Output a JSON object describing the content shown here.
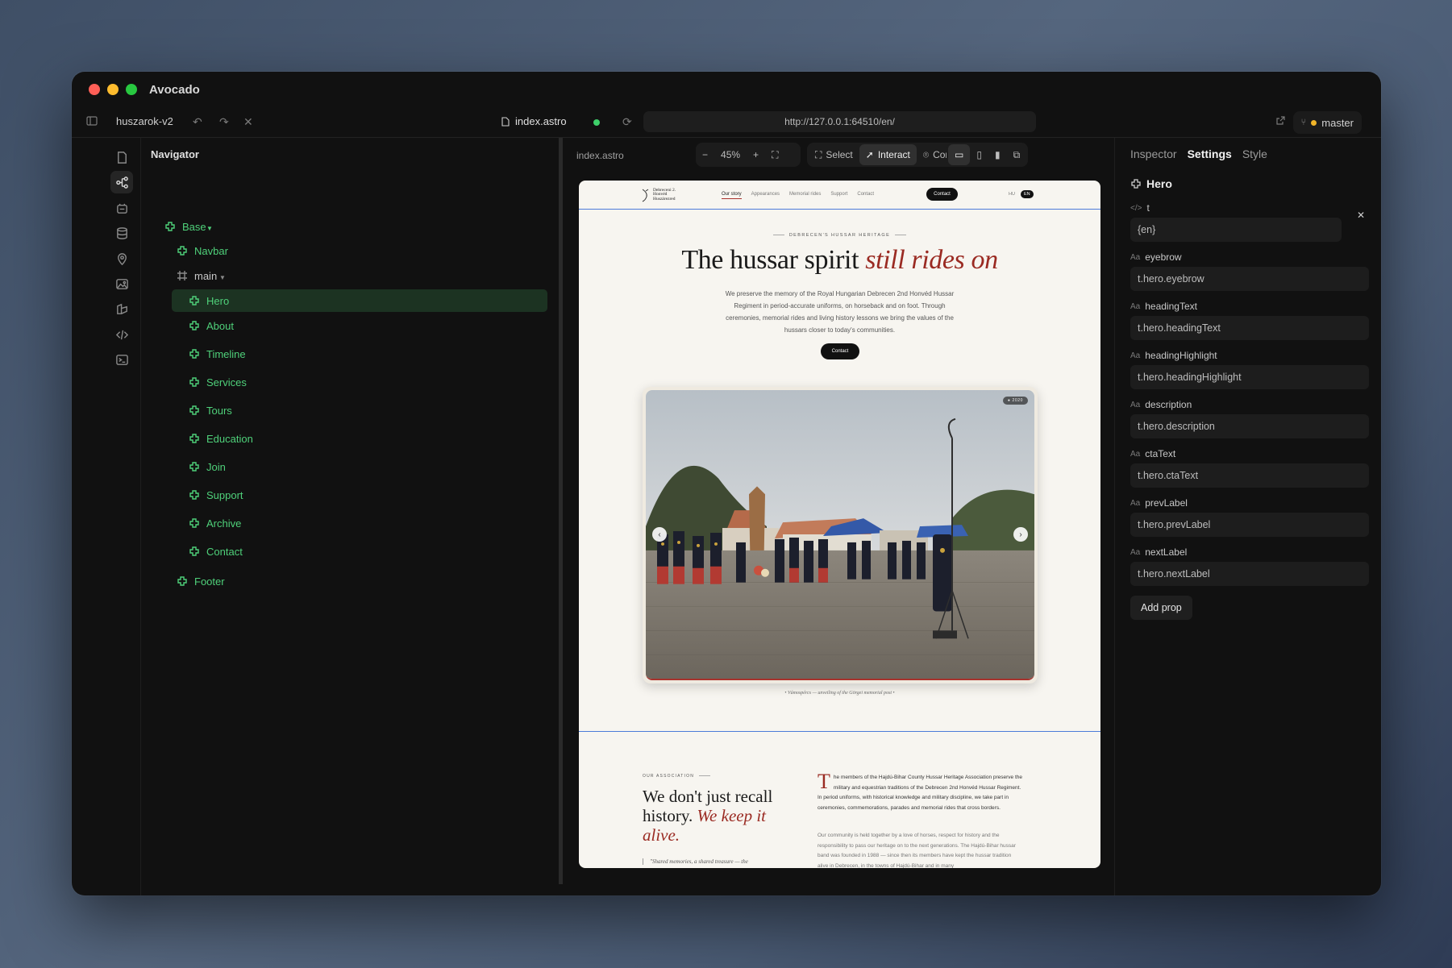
{
  "app": {
    "title": "Avocado",
    "project": "huszarok-v2",
    "file": "index.astro",
    "url": "http://127.0.0.1:64510/en/",
    "branch": "master"
  },
  "colors": {
    "accent_green": "#4fd17a",
    "brand_red": "#9a2a22",
    "selection_blue": "#4c7bd9"
  },
  "navigator": {
    "title": "Navigator",
    "items": [
      {
        "label": "Base"
      },
      {
        "label": "Navbar"
      },
      {
        "label": "main"
      },
      {
        "label": "Hero"
      },
      {
        "label": "About"
      },
      {
        "label": "Timeline"
      },
      {
        "label": "Services"
      },
      {
        "label": "Tours"
      },
      {
        "label": "Education"
      },
      {
        "label": "Join"
      },
      {
        "label": "Support"
      },
      {
        "label": "Archive"
      },
      {
        "label": "Contact"
      },
      {
        "label": "Footer"
      }
    ]
  },
  "canvas": {
    "crumb": "index.astro",
    "zoom": "45%",
    "zoom_out": "−",
    "zoom_in": "+",
    "modes": {
      "select": "Select",
      "interact": "Interact",
      "comment": "Comment"
    }
  },
  "site": {
    "logo": "Debreceni 2. Honvéd Huszárezred",
    "nav": [
      "Our story",
      "Appearances",
      "Memorial rides",
      "Support",
      "Contact"
    ],
    "nav_cta": "Contact",
    "langs": [
      "HU",
      "EN"
    ],
    "eyebrow": "DEBRECEN'S HUSSAR HERITAGE",
    "heading": "The hussar spirit ",
    "heading_highlight": "still rides on",
    "description": "We preserve the memory of the Royal Hungarian Debrecen 2nd Honvéd Hussar Regiment in period-accurate uniforms, on horseback and on foot. Through ceremonies, memorial rides and living history lessons we bring the values of the hussars closer to today's communities.",
    "cta": "Contact",
    "photo_pill": "● 2020",
    "prev": "‹",
    "next": "›",
    "caption": "•  Vámospércs — unveiling of the Görgei memorial post  •",
    "about": {
      "eyebrow": "OUR ASSOCIATION",
      "title_a": "We don't just recall history. ",
      "title_b": "We keep it alive.",
      "quote": "\"Shared memories, a shared treasure — the",
      "dropcap": "T",
      "body1": "he members of the Hajdú-Bihar County Hussar Heritage Association preserve the military and equestrian traditions of the Debrecen 2nd Honvéd Hussar Regiment. In period uniforms, with historical knowledge and military discipline, we take part in ceremonies, commemorations, parades and memorial rides that cross borders.",
      "body2": "Our community is held together by a love of horses, respect for history and the responsibility to pass our heritage on to the next generations. The Hajdú-Bihar hussar band was founded in 1988 — since then its members have kept the hussar tradition alive in Debrecen, in the towns of Hajdú-Bihar and in many"
    }
  },
  "inspector": {
    "tabs": [
      "Inspector",
      "Settings",
      "Style"
    ],
    "component": "Hero",
    "t_label": "t",
    "t_value": "{en}",
    "props": [
      {
        "name": "eyebrow",
        "value": "t.hero.eyebrow"
      },
      {
        "name": "headingText",
        "value": "t.hero.headingText"
      },
      {
        "name": "headingHighlight",
        "value": "t.hero.headingHighlight"
      },
      {
        "name": "description",
        "value": "t.hero.description"
      },
      {
        "name": "ctaText",
        "value": "t.hero.ctaText"
      },
      {
        "name": "prevLabel",
        "value": "t.hero.prevLabel"
      },
      {
        "name": "nextLabel",
        "value": "t.hero.nextLabel"
      }
    ],
    "prop_kind": "Aa",
    "add_prop": "Add prop"
  }
}
